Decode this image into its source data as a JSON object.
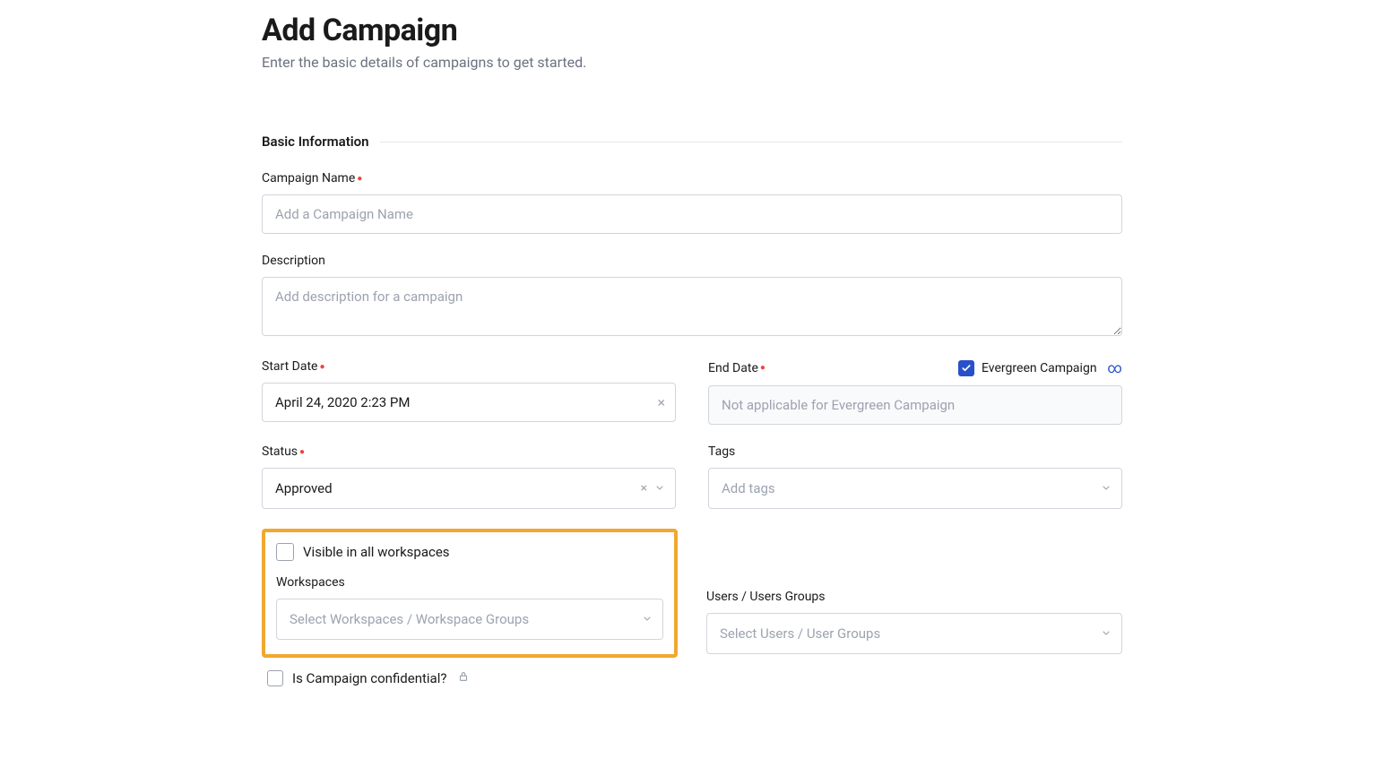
{
  "header": {
    "title": "Add Campaign",
    "subtitle": "Enter the basic details of campaigns to get started."
  },
  "section": {
    "basic_info_label": "Basic Information"
  },
  "fields": {
    "campaign_name": {
      "label": "Campaign Name",
      "placeholder": "Add a Campaign Name",
      "required": true
    },
    "description": {
      "label": "Description",
      "placeholder": "Add description for a campaign",
      "required": false
    },
    "start_date": {
      "label": "Start Date",
      "value": "April 24, 2020 2:23 PM",
      "required": true
    },
    "end_date": {
      "label": "End Date",
      "placeholder": "Not applicable for Evergreen Campaign",
      "required": true
    },
    "evergreen": {
      "label": "Evergreen Campaign",
      "checked": true
    },
    "status": {
      "label": "Status",
      "value": "Approved",
      "required": true
    },
    "tags": {
      "label": "Tags",
      "placeholder": "Add tags"
    },
    "visible_all": {
      "label": "Visible in all workspaces",
      "checked": false
    },
    "workspaces": {
      "label": "Workspaces",
      "placeholder": "Select Workspaces / Workspace Groups"
    },
    "users_groups": {
      "label": "Users / Users Groups",
      "placeholder": "Select Users / User Groups"
    },
    "confidential": {
      "label": "Is Campaign confidential?",
      "checked": false
    }
  }
}
